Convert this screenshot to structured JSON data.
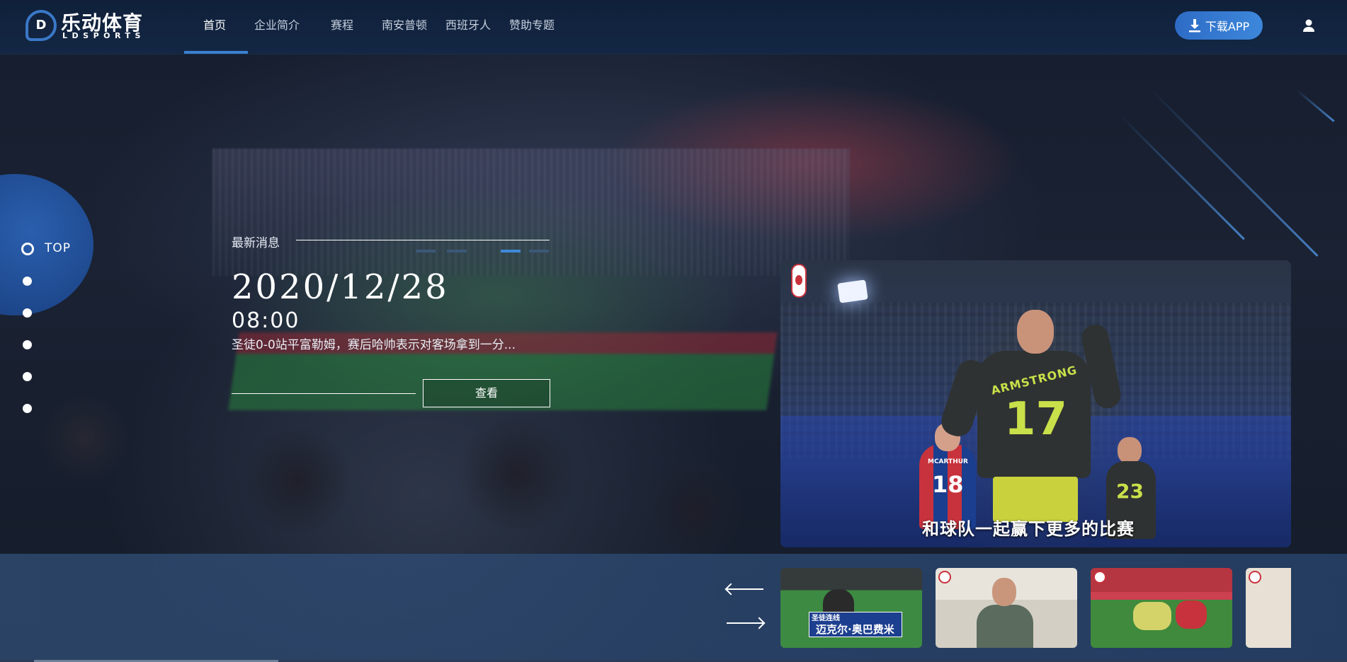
{
  "brand": {
    "mark": "D",
    "name_cn": "乐动体育",
    "name_en": "LDSPORTS"
  },
  "nav": {
    "items": [
      {
        "label": "首页",
        "active": true
      },
      {
        "label": "企业简介",
        "active": false
      },
      {
        "label": "赛程",
        "active": false
      },
      {
        "label": "南安普顿",
        "active": false
      },
      {
        "label": "西班牙人",
        "active": false
      },
      {
        "label": "赞助专题",
        "active": false
      }
    ]
  },
  "header": {
    "download_label": "下载APP",
    "user_icon": "user-icon"
  },
  "side_nav": {
    "top_label": "TOP",
    "dot_count": 5
  },
  "news": {
    "section_label": "最新消息",
    "date": "2020/12/28",
    "time": "08:00",
    "title": "圣徒0-0站平富勒姆，赛后哈帅表示对客场拿到一分...",
    "view_label": "查看",
    "pager_count": 4,
    "pager_active": 2
  },
  "feature": {
    "caption": "和球队一起赢下更多的比赛",
    "player_main_name": "ARMSTRONG",
    "player_main_number": "17",
    "player_left_name": "MCARTHUR",
    "player_left_number": "18",
    "player_right_number": "23"
  },
  "gallery": {
    "thumbs": [
      {
        "label_top": "圣徒连线",
        "label_main": "迈克尔·奥巴费米",
        "caption": ""
      },
      {
        "caption": ""
      },
      {
        "caption": ""
      },
      {
        "caption": ""
      }
    ]
  },
  "colors": {
    "accent": "#3b7fd0",
    "header_bg": "#132744",
    "download_btn": "#3d87db"
  }
}
